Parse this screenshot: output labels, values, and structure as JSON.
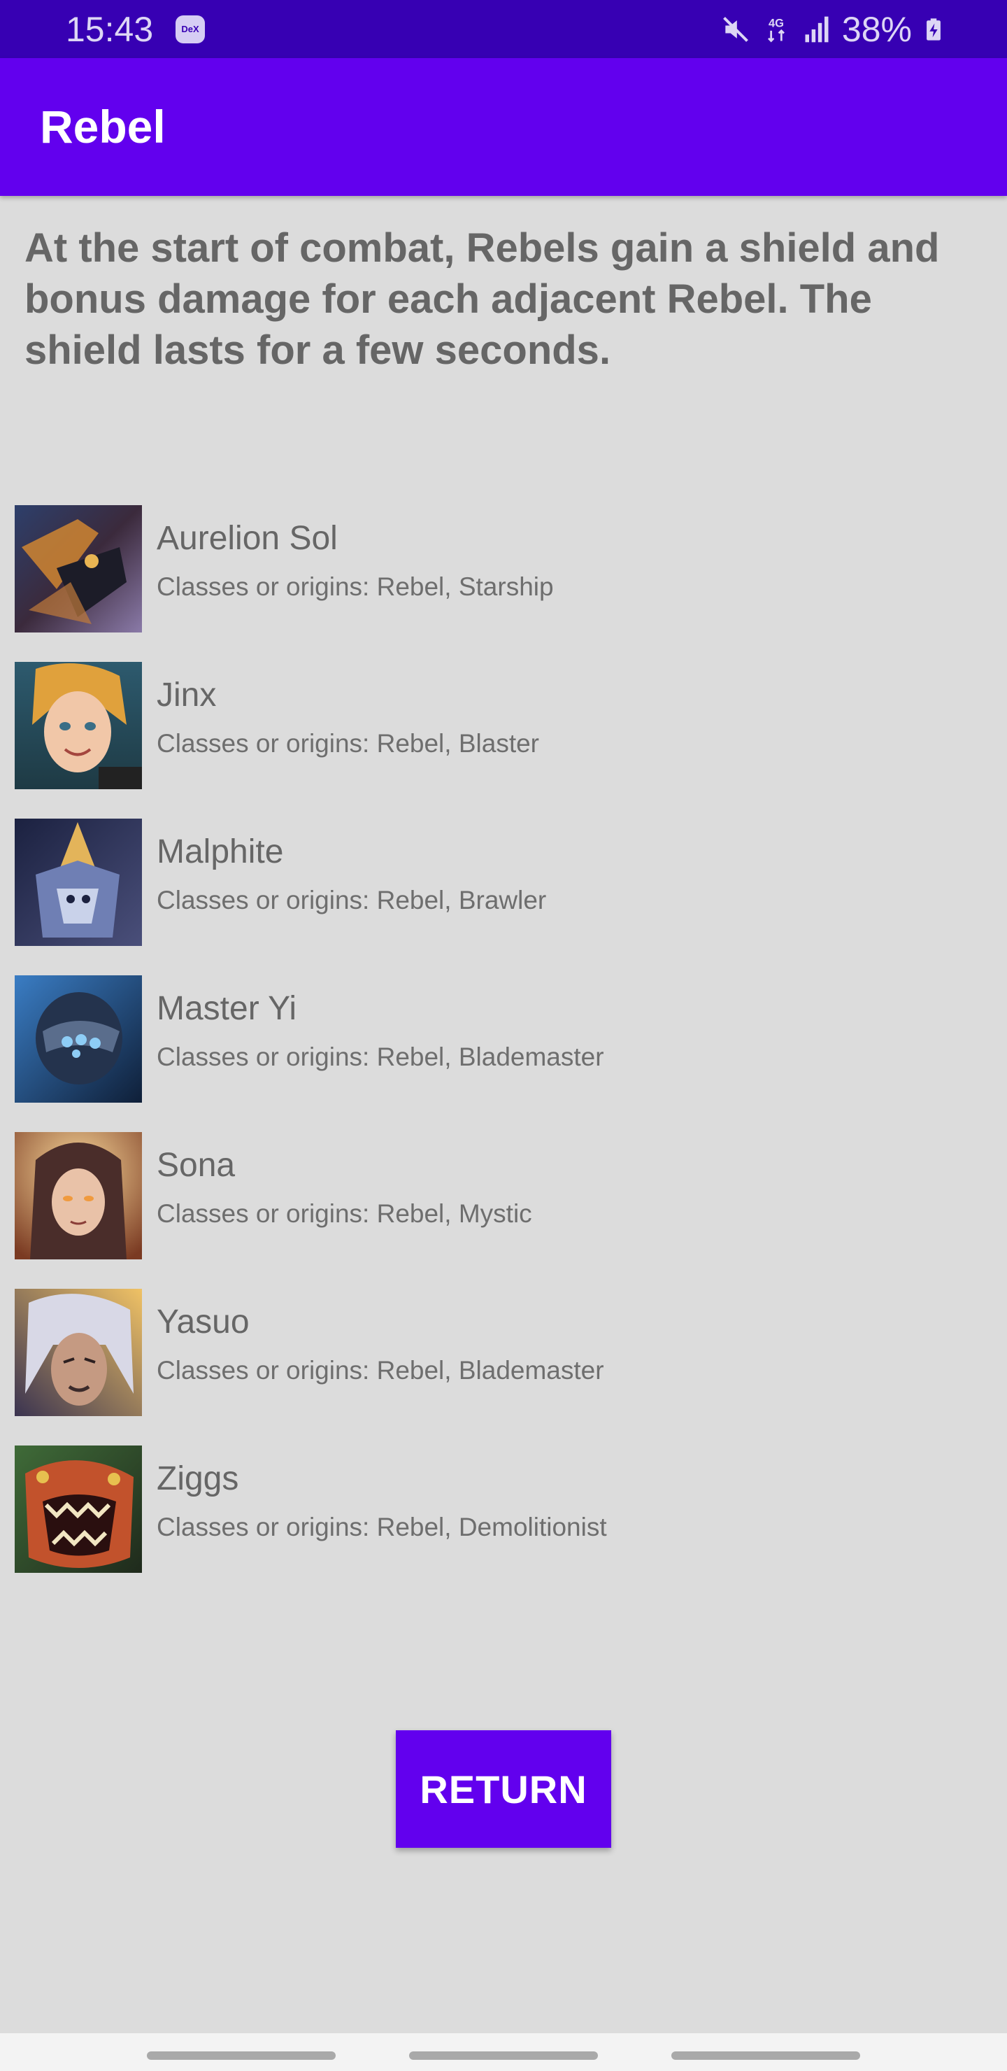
{
  "status_bar": {
    "time": "15:43",
    "dex_badge": "DeX",
    "network": "4G",
    "battery": "38%",
    "icons": [
      "mute-icon",
      "network-4g-icon",
      "signal-icon",
      "battery-charging-icon"
    ]
  },
  "app_bar": {
    "title": "Rebel"
  },
  "description": "At the start of combat, Rebels gain a shield and bonus damage for each adjacent Rebel. The shield lasts for a few seconds.",
  "champions": [
    {
      "name": "Aurelion Sol",
      "classes": "Classes or origins: Rebel, Starship",
      "portrait": "aurelion-sol-portrait"
    },
    {
      "name": "Jinx",
      "classes": "Classes or origins: Rebel, Blaster",
      "portrait": "jinx-portrait"
    },
    {
      "name": "Malphite",
      "classes": "Classes or origins: Rebel, Brawler",
      "portrait": "malphite-portrait"
    },
    {
      "name": "Master Yi",
      "classes": "Classes or origins: Rebel, Blademaster",
      "portrait": "master-yi-portrait"
    },
    {
      "name": "Sona",
      "classes": "Classes or origins: Rebel, Mystic",
      "portrait": "sona-portrait"
    },
    {
      "name": "Yasuo",
      "classes": "Classes or origins: Rebel, Blademaster",
      "portrait": "yasuo-portrait"
    },
    {
      "name": "Ziggs",
      "classes": "Classes or origins: Rebel, Demolitionist",
      "portrait": "ziggs-portrait"
    }
  ],
  "return_button": {
    "label": "RETURN"
  },
  "colors": {
    "status_bar": "#3700b3",
    "app_bar": "#6200ee",
    "background": "#dcdcdc",
    "text": "#666666",
    "button": "#6200ee"
  }
}
